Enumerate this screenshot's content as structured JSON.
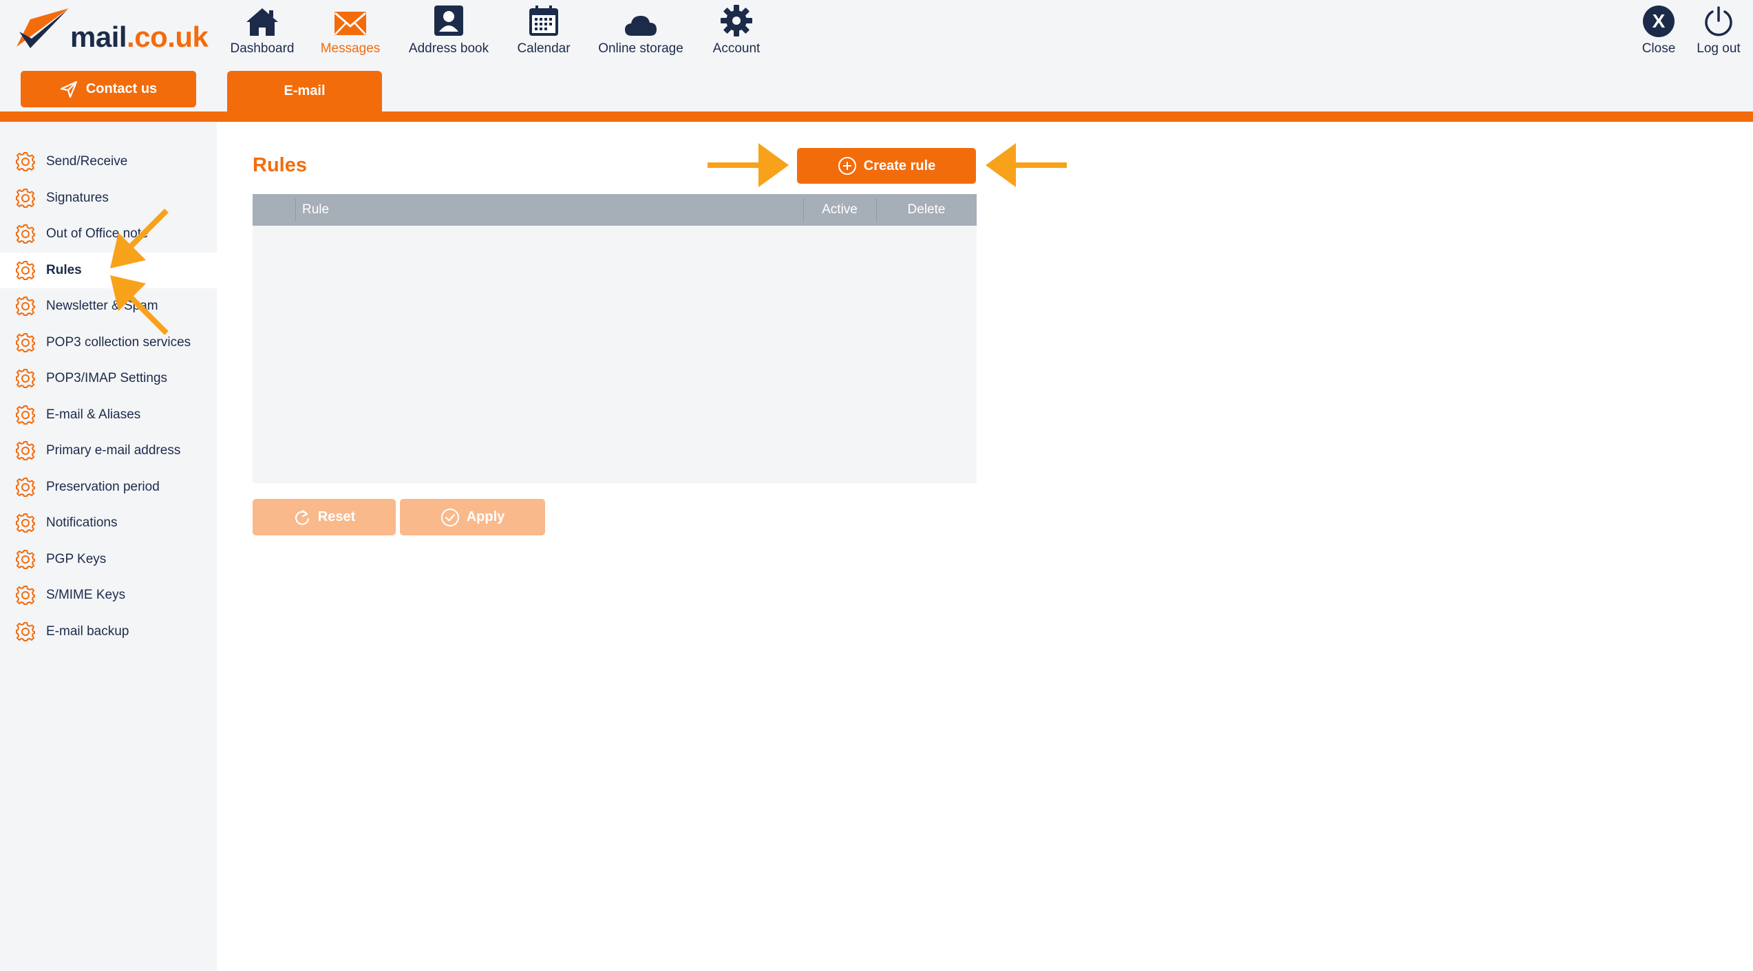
{
  "logo": {
    "part1": "mail",
    "part2": ".co.uk"
  },
  "header": {
    "contact_label": "Contact us",
    "nav": [
      {
        "label": "Dashboard",
        "icon": "home-icon"
      },
      {
        "label": "Messages",
        "icon": "envelope-icon",
        "active": true
      },
      {
        "label": "Address book",
        "icon": "contact-card-icon"
      },
      {
        "label": "Calendar",
        "icon": "calendar-icon"
      },
      {
        "label": "Online storage",
        "icon": "cloud-icon"
      },
      {
        "label": "Account",
        "icon": "gear-icon"
      }
    ],
    "close_label": "Close",
    "close_glyph": "X",
    "logout_label": "Log out",
    "tab_label": "E-mail"
  },
  "sidebar": {
    "items": [
      {
        "label": "Send/Receive"
      },
      {
        "label": "Signatures"
      },
      {
        "label": "Out of Office note"
      },
      {
        "label": "Rules",
        "active": true
      },
      {
        "label": "Newsletter & Spam"
      },
      {
        "label": "POP3 collection services"
      },
      {
        "label": "POP3/IMAP Settings"
      },
      {
        "label": "E-mail & Aliases"
      },
      {
        "label": "Primary e-mail address"
      },
      {
        "label": "Preservation period"
      },
      {
        "label": "Notifications"
      },
      {
        "label": "PGP Keys"
      },
      {
        "label": "S/MIME Keys"
      },
      {
        "label": "E-mail backup"
      }
    ]
  },
  "main": {
    "title": "Rules",
    "create_label": "Create rule",
    "table": {
      "col_rule": "Rule",
      "col_active": "Active",
      "col_delete": "Delete"
    },
    "reset_label": "Reset",
    "apply_label": "Apply"
  },
  "colors": {
    "brand_orange": "#f36c0c",
    "navy": "#1c2b4a",
    "annotation_arrow": "#f8a21b",
    "table_header": "#a6aeb8",
    "panel_bg": "#f4f5f7"
  }
}
